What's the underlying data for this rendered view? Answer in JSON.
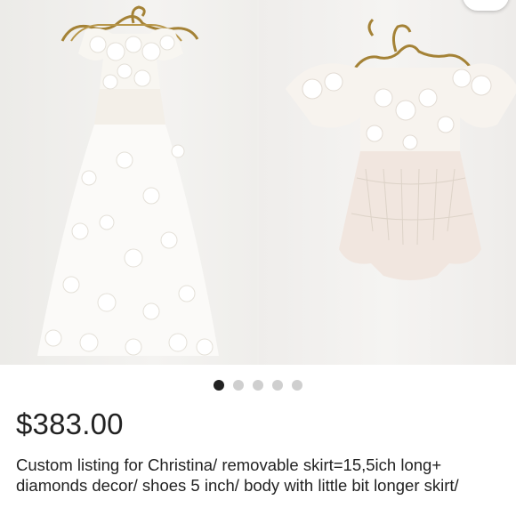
{
  "listing": {
    "price": "$383.00",
    "description": "Custom listing for Christina/ removable skirt=15,5ich long+ diamonds decor/ shoes 5 inch/ body with little bit longer skirt/"
  },
  "gallery": {
    "photos": [
      "photo-1",
      "photo-2"
    ],
    "carousel": {
      "total": 5,
      "active": 1
    }
  },
  "colors": {
    "background": "#ffffff",
    "text": "#222222",
    "dot_active": "#222222",
    "dot_inactive": "#cfcfcf"
  }
}
